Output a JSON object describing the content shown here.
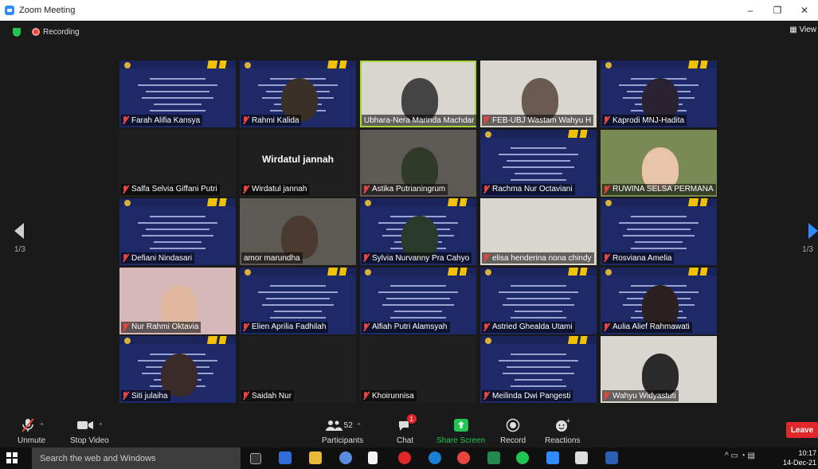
{
  "window": {
    "title": "Zoom Meeting",
    "controls": [
      "–",
      "❐",
      "✕"
    ]
  },
  "meeting": {
    "recording_label": "Recording",
    "view_label": "View",
    "page_indicator_left": "1/3",
    "page_indicator_right": "1/3"
  },
  "center_tile_name": "Wirdatul jannah",
  "participants": [
    "Farah Alifia Kansya",
    "Rahmi Kalida",
    "Ubhara-Nera Marinda Machdar",
    "FEB-UBJ Wastam Wahyu H",
    "Kaprodi MNJ-Hadita",
    "Salfa Selvia Giffani Putri",
    "Wirdatul jannah",
    "Astika Putrianingrum",
    "Rachma Nur Octaviani",
    "RUWINA SELSA PERMANA ...",
    "Defiani Nindasari",
    "amor marundha",
    "Sylvia Nurvanny Pra Cahyo",
    "elisa henderina nona chindy",
    "Rosviana Amelia",
    "Nur Rahmi Oktavia",
    "Elien Aprilia Fadhilah",
    "Alfiah Putri Alamsyah",
    "Astried Ghealda Utami",
    "Aulia Alief Rahmawati",
    "Siti julaiha",
    "Saidah Nur",
    "Khoirunnisa",
    "Meilinda Dwi Pangesti",
    "Wahyu Widyastuti"
  ],
  "toolbar": {
    "unmute": "Unmute",
    "stop_video": "Stop Video",
    "participants": "Participants",
    "participants_count": "52",
    "chat": "Chat",
    "chat_badge": "1",
    "share_screen": "Share Screen",
    "record": "Record",
    "reactions": "Reactions",
    "leave": "Leave"
  },
  "taskbar": {
    "search_placeholder": "Search the web and Windows",
    "time": "10:17",
    "date": "14-Dec-21"
  },
  "colors": {
    "accent": "#2d8cff",
    "share_green": "#23c552",
    "leave_red": "#e02828",
    "muted_red": "#e8453c",
    "active_speaker": "#a8d63b"
  }
}
